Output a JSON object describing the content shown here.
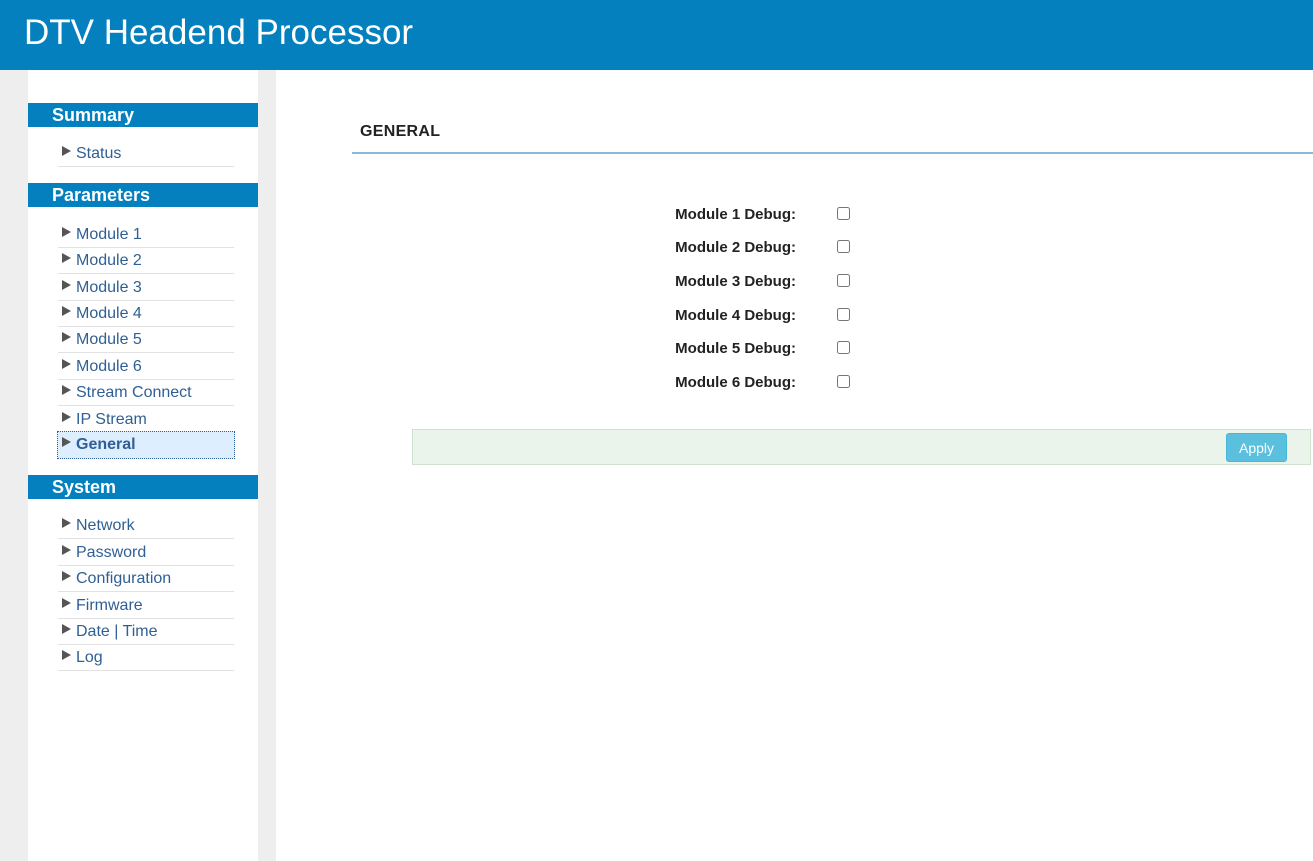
{
  "header": {
    "title": "DTV Headend Processor"
  },
  "sidebar": {
    "sections": [
      {
        "title": "Summary",
        "items": [
          "Status"
        ]
      },
      {
        "title": "Parameters",
        "items": [
          "Module 1",
          "Module 2",
          "Module 3",
          "Module 4",
          "Module 5",
          "Module 6",
          "Stream Connect",
          "IP Stream",
          "General"
        ]
      },
      {
        "title": "System",
        "items": [
          "Network",
          "Password",
          "Configuration",
          "Firmware",
          "Date | Time",
          "Log"
        ]
      }
    ],
    "active_item": "General"
  },
  "main": {
    "title": "GENERAL",
    "debug_rows": [
      {
        "label": "Module 1 Debug:",
        "checked": false
      },
      {
        "label": "Module 2 Debug:",
        "checked": false
      },
      {
        "label": "Module 3 Debug:",
        "checked": false
      },
      {
        "label": "Module 4 Debug:",
        "checked": false
      },
      {
        "label": "Module 5 Debug:",
        "checked": false
      },
      {
        "label": "Module 6 Debug:",
        "checked": false
      }
    ],
    "apply_label": "Apply"
  },
  "colors": {
    "brand": "#0480be",
    "link": "#2f5f93",
    "apply_button": "#5bc0de",
    "action_bar": "#eaf4ea"
  },
  "icons": {
    "nav_arrow": "triangle-right-icon"
  }
}
